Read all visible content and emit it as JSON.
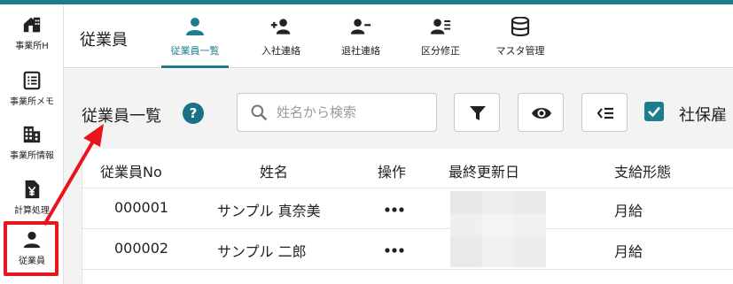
{
  "sidebar": {
    "items": [
      {
        "label": "事業所H",
        "icon": "home-building-icon"
      },
      {
        "label": "事業所メモ",
        "icon": "memo-list-icon"
      },
      {
        "label": "事業所情報",
        "icon": "office-building-icon"
      },
      {
        "label": "計算処理",
        "icon": "yen-document-icon"
      },
      {
        "label": "従業員",
        "icon": "person-icon",
        "active": true
      }
    ]
  },
  "header": {
    "title": "従業員",
    "tabs": [
      {
        "label": "従業員一覧",
        "icon": "person-icon",
        "active": true
      },
      {
        "label": "入社連絡",
        "icon": "person-add-icon"
      },
      {
        "label": "退社連絡",
        "icon": "person-remove-icon"
      },
      {
        "label": "区分修正",
        "icon": "person-list-icon"
      },
      {
        "label": "マスタ管理",
        "icon": "database-icon"
      }
    ]
  },
  "main": {
    "title": "従業員一覧",
    "help_icon": "help-circle-icon",
    "search": {
      "placeholder": "姓名から検索",
      "value": ""
    },
    "toolbar_icons": [
      "filter-icon",
      "eye-icon",
      "column-list-icon"
    ],
    "checkbox": {
      "label": "社保雇",
      "checked": true
    }
  },
  "table": {
    "columns": [
      "従業員No",
      "姓名",
      "操作",
      "最終更新日",
      "支給形態"
    ],
    "rows": [
      {
        "no": "000001",
        "name": "サンプル 真奈美",
        "action": "•••",
        "updated": "",
        "pay_type": "月給"
      },
      {
        "no": "000002",
        "name": "サンプル 二郎",
        "action": "•••",
        "updated": "",
        "pay_type": "月給"
      }
    ]
  },
  "colors": {
    "accent": "#1b7d8e",
    "highlight": "#e8141e"
  }
}
